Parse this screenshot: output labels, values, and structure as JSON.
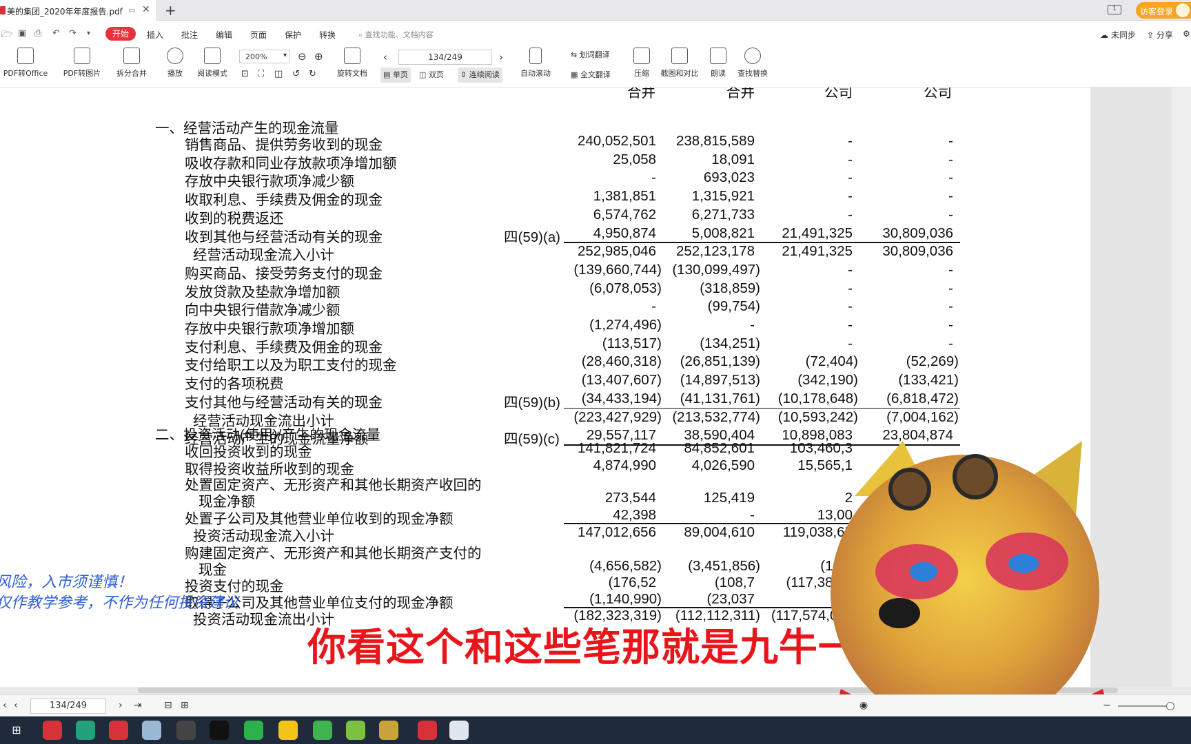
{
  "window": {
    "tab_title": "美的集团_2020年年度报告.pdf",
    "guest_login": "访客登录"
  },
  "menu": {
    "start": "开始",
    "items": [
      "插入",
      "批注",
      "编辑",
      "页面",
      "保护",
      "转换"
    ],
    "search_placeholder": "查找功能、文档内容",
    "sync": "未同步",
    "share": "分享"
  },
  "ribbon": {
    "pdf_to_office": "PDF转Office",
    "pdf_to_image": "PDF转图片",
    "split_merge": "拆分合并",
    "play": "播放",
    "read_mode": "阅读模式",
    "zoom": "200%",
    "rotate_doc": "旋转文档",
    "page_display": "134/249",
    "single_page": "单页",
    "double_page": "双页",
    "continuous": "连续阅读",
    "auto_scroll": "自动滚动",
    "word_translate": "划词翻译",
    "full_translate": "全文翻译",
    "compress": "压缩",
    "screenshot_compare": "截图和对比",
    "read_aloud": "朗读",
    "find_replace": "查找替换"
  },
  "document": {
    "header_cols": [
      "合并",
      "合并",
      "公司",
      "公司"
    ],
    "section1_title": "一、经营活动产生的现金流量",
    "section2_title": "二、投资活动(使用)/产生的现金流量",
    "rows": [
      {
        "label": "销售商品、提供劳务收到的现金",
        "note": "",
        "c1": "240,052,501",
        "c2": "238,815,589",
        "c3": "-",
        "c4": "-"
      },
      {
        "label": "吸收存款和同业存放款项净增加额",
        "note": "",
        "c1": "25,058",
        "c2": "18,091",
        "c3": "-",
        "c4": "-"
      },
      {
        "label": "存放中央银行款项净减少额",
        "note": "",
        "c1": "-",
        "c2": "693,023",
        "c3": "-",
        "c4": "-"
      },
      {
        "label": "收取利息、手续费及佣金的现金",
        "note": "",
        "c1": "1,381,851",
        "c2": "1,315,921",
        "c3": "-",
        "c4": "-"
      },
      {
        "label": "收到的税费返还",
        "note": "",
        "c1": "6,574,762",
        "c2": "6,271,733",
        "c3": "-",
        "c4": "-"
      },
      {
        "label": "收到其他与经营活动有关的现金",
        "note": "四(59)(a)",
        "c1": "4,950,874",
        "c2": "5,008,821",
        "c3": "21,491,325",
        "c4": "30,809,036"
      },
      {
        "label": "经营活动现金流入小计",
        "note": "",
        "c1": "252,985,046",
        "c2": "252,123,178",
        "c3": "21,491,325",
        "c4": "30,809,036"
      },
      {
        "label": "购买商品、接受劳务支付的现金",
        "note": "",
        "c1": "(139,660,744)",
        "c2": "(130,099,497)",
        "c3": "-",
        "c4": "-"
      },
      {
        "label": "发放贷款及垫款净增加额",
        "note": "",
        "c1": "(6,078,053)",
        "c2": "(318,859)",
        "c3": "-",
        "c4": "-"
      },
      {
        "label": "向中央银行借款净减少额",
        "note": "",
        "c1": "-",
        "c2": "(99,754)",
        "c3": "-",
        "c4": "-"
      },
      {
        "label": "存放中央银行款项净增加额",
        "note": "",
        "c1": "(1,274,496)",
        "c2": "-",
        "c3": "-",
        "c4": "-"
      },
      {
        "label": "支付利息、手续费及佣金的现金",
        "note": "",
        "c1": "(113,517)",
        "c2": "(134,251)",
        "c3": "-",
        "c4": "-"
      },
      {
        "label": "支付给职工以及为职工支付的现金",
        "note": "",
        "c1": "(28,460,318)",
        "c2": "(26,851,139)",
        "c3": "(72,404)",
        "c4": "(52,269)"
      },
      {
        "label": "支付的各项税费",
        "note": "",
        "c1": "(13,407,607)",
        "c2": "(14,897,513)",
        "c3": "(342,190)",
        "c4": "(133,421)"
      },
      {
        "label": "支付其他与经营活动有关的现金",
        "note": "四(59)(b)",
        "c1": "(34,433,194)",
        "c2": "(41,131,761)",
        "c3": "(10,178,648)",
        "c4": "(6,818,472)"
      },
      {
        "label": "经营活动现金流出小计",
        "note": "",
        "c1": "(223,427,929)",
        "c2": "(213,532,774)",
        "c3": "(10,593,242)",
        "c4": "(7,004,162)"
      },
      {
        "label": "经营活动产生的现金流量净额",
        "note": "四(59)(c)",
        "c1": "29,557,117",
        "c2": "38,590,404",
        "c3": "10,898,083",
        "c4": "23,804,874"
      }
    ],
    "inv_rows": [
      {
        "label": "收回投资收到的现金",
        "c1": "141,821,724",
        "c2": "84,852,601",
        "c3": "103,460,3"
      },
      {
        "label": "取得投资收益所收到的现金",
        "c1": "4,874,990",
        "c2": "4,026,590",
        "c3": "15,565,1"
      },
      {
        "label": "处置固定资产、无形资产和其他长期资产收回的",
        "c1": "",
        "c2": "",
        "c3": ""
      },
      {
        "label": "现金净额",
        "c1": "273,544",
        "c2": "125,419",
        "c3": "2"
      },
      {
        "label": "处置子公司及其他营业单位收到的现金净额",
        "c1": "42,398",
        "c2": "-",
        "c3": "13,00"
      },
      {
        "label": "投资活动现金流入小计",
        "c1": "147,012,656",
        "c2": "89,004,610",
        "c3": "119,038,65"
      },
      {
        "label": "购建固定资产、无形资产和其他长期资产支付的",
        "c1": "",
        "c2": "",
        "c3": ""
      },
      {
        "label": "现金",
        "c1": "(4,656,582)",
        "c2": "(3,451,856)",
        "c3": "(187,"
      },
      {
        "label": "投资支付的现金",
        "c1": "(176,52",
        "c2": "(108,7",
        "c3": "(117,386,2"
      },
      {
        "label": "取得子公司及其他营业单位支付的现金净额",
        "c1": "(1,140,990)",
        "c2": "(23,037",
        "c3": ""
      },
      {
        "label": "投资活动现金流出小计",
        "c1": "(182,323,319)",
        "c2": "(112,112,311)",
        "c3": "(117,574,004)"
      }
    ]
  },
  "overlay": {
    "disclaimer_line1": "风险，入市须谨慎！",
    "disclaimer_line2": "仅作教学参考，不作为任何投资建议",
    "caption": "你看这个和这些笔那就是九牛一毛"
  },
  "statusbar": {
    "page": "134/249"
  }
}
